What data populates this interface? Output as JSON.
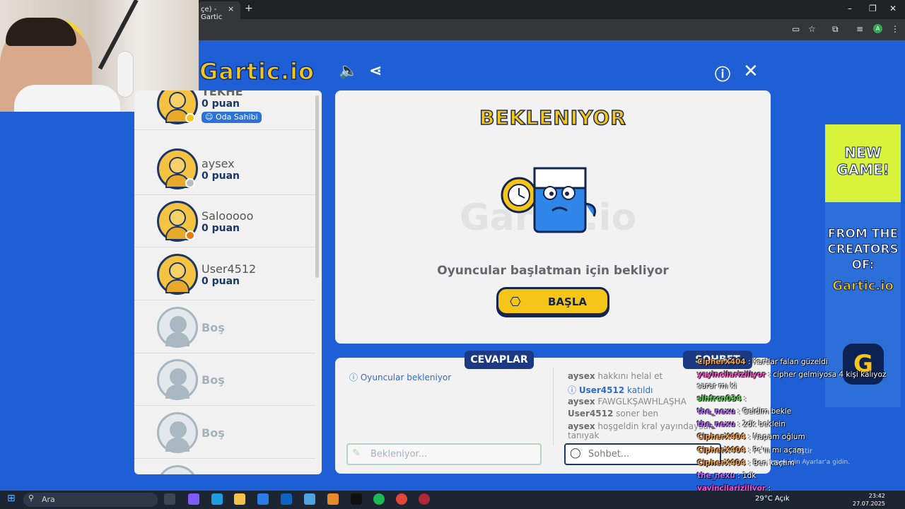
{
  "browser": {
    "tab_title": "çe) - Gartic",
    "tab_close": "×",
    "new_tab": "+",
    "minimize": "–",
    "restore": "❐",
    "close": "✕",
    "profile_letter": "A"
  },
  "game": {
    "logo": "Gartic.io",
    "players": [
      {
        "name": "TEKHE",
        "score": "0 puan",
        "badge": "Oda Sahibi",
        "status_color": "#f5c518"
      },
      {
        "name": "aysex",
        "score": "0 puan",
        "status_color": "#bdbdbd"
      },
      {
        "name": "Salooooo",
        "score": "0 puan",
        "status_color": "#e57c12"
      },
      {
        "name": "User4512",
        "score": "0 puan"
      },
      {
        "name": "Boş"
      },
      {
        "name": "Boş"
      },
      {
        "name": "Boş"
      }
    ],
    "stage": {
      "title": "BEKLENIYOR",
      "watermark": "Gartic.io",
      "message": "Oyuncular başlatman için bekliyor",
      "start_label": "BAŞLA"
    },
    "answers": {
      "tab": "CEVAPLAR",
      "info": "Oyuncular bekleniyor",
      "placeholder": "Bekleniyor..."
    },
    "chat": {
      "tab": "SOHBET",
      "placeholder": "Sohbet...",
      "messages": [
        {
          "user": "aysex",
          "text": "hakkını helal et"
        },
        {
          "user": "User4512",
          "text": "katıldı"
        },
        {
          "user": "aysex",
          "text": "FAWGLKŞAWHLAŞHA"
        },
        {
          "user": "User4512",
          "text": "soner ben"
        },
        {
          "user": "aysex",
          "text": "hoşgeldin kral yayındaysan",
          "text2": "tanıyak"
        }
      ]
    }
  },
  "ad": {
    "line1": "NEW",
    "line2": "GAME!",
    "line3": "FROM THE",
    "line4": "CREATORS",
    "line5": "OF:",
    "logo": "Gartic.io",
    "app_icon": "G"
  },
  "overlay_chat": [
    {
      "name": "CipherX404",
      "text": ": Kartlar falan güzeldi",
      "color": "#f0a04b"
    },
    {
      "name": "yayincilariziliyor",
      "text": ": cipher gelmiyosa 4 kişi kalıyoz",
      "color": "#ff4fd0"
    },
    {
      "name": "",
      "text": "sarar mı ki",
      "color": "#ffffff"
    },
    {
      "name": "slhfrcn034",
      "text": ":",
      "color": "#58d354"
    },
    {
      "name": "the_nexu",
      "text": ": Geldim bekle",
      "color": "#b86cff"
    },
    {
      "name": "the_nexu",
      "text": ": 2dk beklein",
      "color": "#b86cff"
    },
    {
      "name": "CipherX404",
      "text": ": Napam oğlum",
      "color": "#f0a04b"
    },
    {
      "name": "CipherX404",
      "text": ": Pc'ııı mı açam",
      "color": "#f0a04b"
    },
    {
      "name": "CipherX404",
      "text": ": Ben kaçtım",
      "color": "#f0a04b"
    },
    {
      "name": "the_nexu",
      "text": ": 1dk",
      "color": "#b86cff"
    },
    {
      "name": "yayincilariziliyor",
      "text": ":",
      "color": "#ff4fd0"
    },
    {
      "name": "slhfrcn034",
      "text": ":",
      "color": "#58d354"
    }
  ],
  "overlay_faint": {
    "line1": "leştir",
    "line2": "tirmek için Ayarlar'a gidin."
  },
  "taskbar": {
    "search": "Ara",
    "weather": "29°C  Açık",
    "time": "23:42",
    "date": "27.07.2025"
  }
}
